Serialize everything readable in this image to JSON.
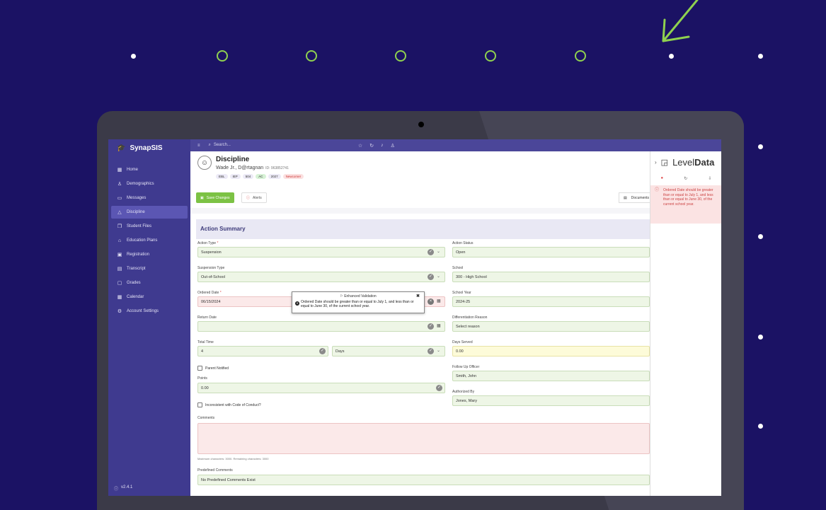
{
  "app": {
    "brand": "SynapSIS",
    "version": "v2.4.1"
  },
  "sidebar": {
    "items": [
      {
        "label": "Home",
        "icon": "grid-icon"
      },
      {
        "label": "Demographics",
        "icon": "person-icon"
      },
      {
        "label": "Messages",
        "icon": "chat-icon"
      },
      {
        "label": "Discipline",
        "icon": "warning-icon",
        "active": true
      },
      {
        "label": "Student Files",
        "icon": "files-icon"
      },
      {
        "label": "Education Plans",
        "icon": "building-icon"
      },
      {
        "label": "Registration",
        "icon": "briefcase-icon"
      },
      {
        "label": "Transcript",
        "icon": "document-icon"
      },
      {
        "label": "Grades",
        "icon": "clipboard-icon"
      },
      {
        "label": "Calendar",
        "icon": "calendar-icon"
      },
      {
        "label": "Account Settings",
        "icon": "settings-user-icon"
      }
    ]
  },
  "topbar": {
    "search_placeholder": "Search..."
  },
  "header": {
    "title": "Discipline",
    "student_name": "Wade Jr., D@rtagnan",
    "student_id": "ID: 963852741",
    "badges": [
      "EBL",
      "IEP",
      "504",
      "AC",
      "2027",
      "Newcomer"
    ]
  },
  "toolbar": {
    "save_label": "Save Changes",
    "alerts_label": "Alerts",
    "documents_label": "Documents"
  },
  "section": {
    "title": "Action Summary"
  },
  "form": {
    "action_type_label": "Action Type",
    "action_type_value": "Suspension",
    "suspension_type_label": "Suspension Type",
    "suspension_type_value": "Out-of-School",
    "ordered_date_label": "Ordered Date",
    "ordered_date_value": "06/15/2024",
    "return_date_label": "Return Date",
    "return_date_value": "",
    "total_time_label": "Total Time",
    "total_time_value": "4",
    "total_time_unit": "Days",
    "parent_notified_label": "Parent Notified",
    "points_label": "Points",
    "points_value": "0.00",
    "inconsistent_label": "Inconsistent with Code of Conduct?",
    "comments_label": "Comments",
    "comments_hint": "Maximum characters: 3000. Remaining characters: 3000",
    "predefined_label": "Predefined Comments",
    "predefined_value": "No Predefined Comments Exist",
    "action_status_label": "Action Status",
    "action_status_value": "Open",
    "school_label": "School",
    "school_value": "300 - High School",
    "school_year_label": "School Year",
    "school_year_value": "2024-25",
    "diff_reason_label": "Differentiation Reason",
    "diff_reason_value": "Select reason",
    "days_served_label": "Days Served",
    "days_served_value": "0.00",
    "follow_up_label": "Follow Up Officer",
    "follow_up_value": "Smith, John",
    "authorized_label": "Authorized By",
    "authorized_value": "Jones, Mary"
  },
  "popup": {
    "title": "Enhanced Validation",
    "message": "Ordered Date should be greater than or equal to July 1, and less than or equal to June 30, of the current school year."
  },
  "panel": {
    "logo_light": "Level",
    "logo_bold": "Data",
    "alert": "Ordered Date should be greater than or equal to July 1, and less than or equal to June 30, of the current school year."
  },
  "colors": {
    "background": "#1b1264",
    "accent_green": "#8fd14f",
    "sidebar": "#3f3a8f",
    "valid_field": "#eef6e6",
    "error_field": "#fbe9e9",
    "warning_field": "#fdfbd9"
  }
}
